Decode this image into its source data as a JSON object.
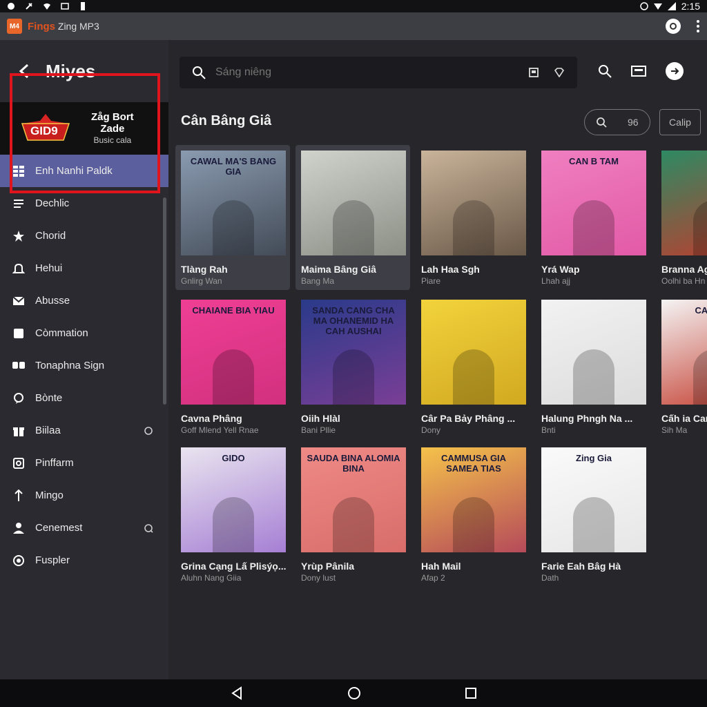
{
  "status_bar": {
    "time": "2:15"
  },
  "app_bar": {
    "logo_text": "M4",
    "brand": "Fings",
    "title": "Zing MP3"
  },
  "sidebar": {
    "title": "Miyes",
    "promo": {
      "badge": "GID9",
      "line1": "Zåg Bort",
      "line2": "Zade",
      "line3": "Busic cala"
    },
    "items": [
      {
        "label": "Enh Nanhi Paldk",
        "icon": "grid-icon",
        "active": true
      },
      {
        "label": "Dechlic",
        "icon": "list-icon"
      },
      {
        "label": "Chorid",
        "icon": "star-icon"
      },
      {
        "label": "Hehui",
        "icon": "bell-icon"
      },
      {
        "label": "Abusse",
        "icon": "mail-icon"
      },
      {
        "label": "Còmmation",
        "icon": "square-icon"
      },
      {
        "label": "Tonaphna Sign",
        "icon": "chat-icon"
      },
      {
        "label": "Bònte",
        "icon": "bubble-icon"
      },
      {
        "label": "Biilaa",
        "icon": "gift-icon",
        "trail": "info-icon"
      },
      {
        "label": "Pinffarm",
        "icon": "frame-icon"
      },
      {
        "label": "Mingo",
        "icon": "pin-icon"
      },
      {
        "label": "Cenemest",
        "icon": "person-icon",
        "trail": "sync-icon"
      },
      {
        "label": "Fuspler",
        "icon": "target-icon"
      }
    ]
  },
  "search": {
    "placeholder": "Sáng niêng"
  },
  "section": {
    "title": "Cân Bâng Giâ",
    "filter_value": "96",
    "button_label": "Calip"
  },
  "cards": [
    {
      "title": "Tlàng Rah",
      "subtitle": "Gnlirg Wan",
      "art_text": "CAWAL MA'S BANG GIA",
      "colors": [
        "#8a9bb0",
        "#434b57"
      ],
      "selected": true
    },
    {
      "title": "Maima Bâng Giâ",
      "subtitle": "Bang Ma",
      "art_text": "",
      "colors": [
        "#cfd3cc",
        "#8b8f86"
      ],
      "selected": true
    },
    {
      "title": "Lah Haa Sgh",
      "subtitle": "Piare",
      "art_text": "",
      "colors": [
        "#c9b49a",
        "#6a5848"
      ]
    },
    {
      "title": "Yrá Wap",
      "subtitle": "Lhah ajj",
      "art_text": "CAN B TAM",
      "colors": [
        "#f07fc0",
        "#e25aa6"
      ]
    },
    {
      "title": "Branna Ag",
      "subtitle": "Oolhi ba Hn",
      "art_text": "",
      "colors": [
        "#2d8a63",
        "#c33a2c"
      ]
    },
    {
      "title": "Cavna Phâng",
      "subtitle": "Goff Mlend Yell Rnae",
      "art_text": "CHAIANE BIA YIAU",
      "colors": [
        "#ef3f94",
        "#d2307f"
      ]
    },
    {
      "title": "Oiih Hlàl",
      "subtitle": "Bani Pllie",
      "art_text": "SANDA CANG CHA MA OHANEMID HA CAH AUSHAI",
      "colors": [
        "#2a3a8a",
        "#7a3f96"
      ]
    },
    {
      "title": "Câr Pa Bảy Phâng ...",
      "subtitle": "Dony",
      "art_text": "",
      "colors": [
        "#f2d33c",
        "#d2a920"
      ]
    },
    {
      "title": "Halung Phngh Na ...",
      "subtitle": "Bnti",
      "art_text": "",
      "colors": [
        "#f2f2f2",
        "#dcdcdc"
      ]
    },
    {
      "title": "Cấh ia Car",
      "subtitle": "Sih Ma",
      "art_text": "CAMA BI",
      "colors": [
        "#f4f4f4",
        "#c33a2c"
      ]
    },
    {
      "title": "Grina Cạng Lấ Plisýọ...",
      "subtitle": "Aluhn Nang Giia",
      "art_text": "GIDO",
      "colors": [
        "#e9e4ef",
        "#a67fd4"
      ]
    },
    {
      "title": "Yrùp Pânila",
      "subtitle": "Dony lust",
      "art_text": "SAUDA BINA ALOMIA BINA",
      "colors": [
        "#ef8a86",
        "#d86d6a"
      ]
    },
    {
      "title": "Hah Mail",
      "subtitle": "Afap 2",
      "art_text": "CAMMUSA GIA SAMEA TIAS",
      "colors": [
        "#f5c24a",
        "#b54a5a"
      ]
    },
    {
      "title": "Farie Eah Bâg Hà",
      "subtitle": "Dath",
      "art_text": "Zing Gia",
      "colors": [
        "#fafafa",
        "#e6e6e6"
      ]
    }
  ]
}
